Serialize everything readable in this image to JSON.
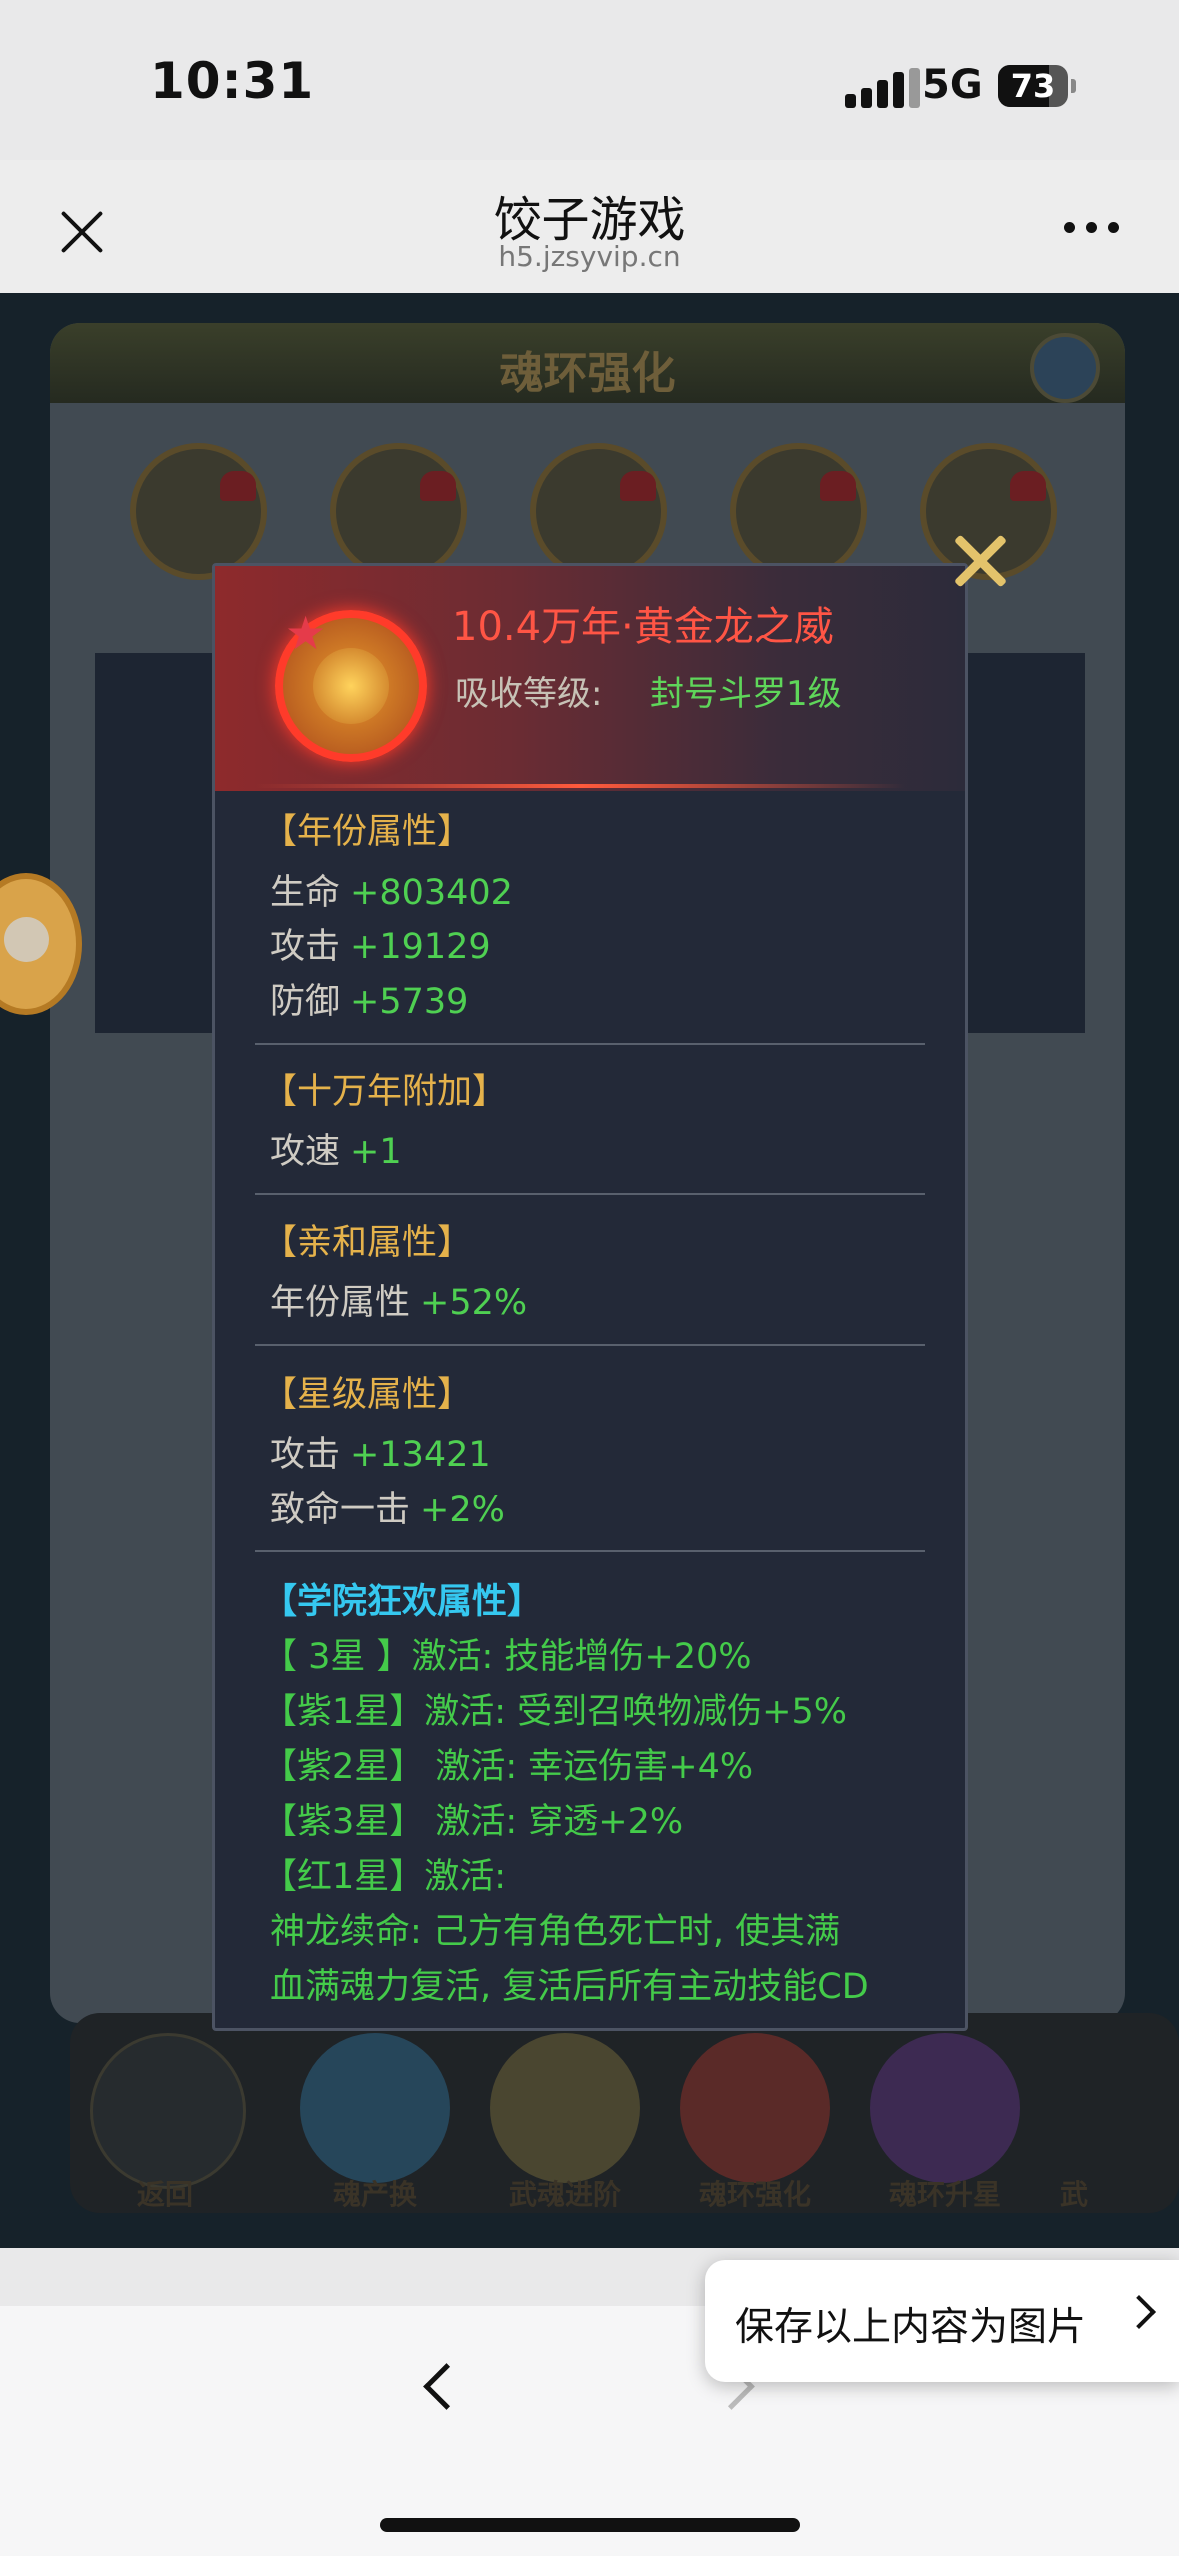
{
  "status_bar": {
    "time": "10:31",
    "network": "5G",
    "battery": "73"
  },
  "header": {
    "title": "饺子游戏",
    "url": "h5.jzsyvip.cn"
  },
  "game_bg": {
    "title": "魂环强化",
    "bottom_buttons": [
      "返回",
      "魂产换",
      "武魂进阶",
      "魂环强化",
      "魂环升星",
      "武"
    ]
  },
  "popup": {
    "name": "10.4万年·黄金龙之威",
    "absorb_label": "吸收等级:",
    "absorb_value": "封号斗罗1级",
    "sections": [
      {
        "title": "【年份属性】",
        "rows": [
          {
            "key": "生命",
            "value": "+803402"
          },
          {
            "key": "攻击",
            "value": "+19129"
          },
          {
            "key": "防御",
            "value": "+5739"
          }
        ]
      },
      {
        "title": "【十万年附加】",
        "rows": [
          {
            "key": "攻速",
            "value": "+1"
          }
        ]
      },
      {
        "title": "【亲和属性】",
        "rows": [
          {
            "key": "年份属性",
            "value": "+52%"
          }
        ]
      },
      {
        "title": "【星级属性】",
        "rows": [
          {
            "key": "攻击",
            "value": "+13421"
          },
          {
            "key": "致命一击",
            "value": "+2%"
          }
        ]
      }
    ],
    "academy": {
      "title": "【学院狂欢属性】",
      "lines": [
        "【 3星 】激活: 技能增伤+20%",
        "【紫1星】激活: 受到召唤物减伤+5%",
        "【紫2星】 激活: 幸运伤害+4%",
        "【紫3星】 激活: 穿透+2%",
        "【红1星】激活:",
        "神龙续命: 己方有角色死亡时, 使其满",
        "血满魂力复活, 复活后所有主动技能CD"
      ]
    }
  },
  "save_button": {
    "label": "保存以上内容为图片"
  }
}
